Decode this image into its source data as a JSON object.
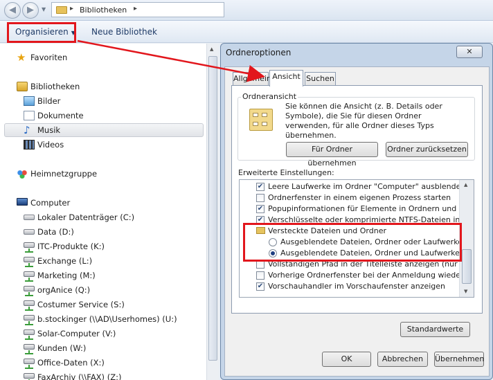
{
  "address_bar": {
    "path": "Bibliotheken"
  },
  "toolbar": {
    "organize": "Organisieren",
    "new_library": "Neue Bibliothek"
  },
  "nav": {
    "favorites": "Favoriten",
    "libraries": "Bibliotheken",
    "library_items": [
      "Bilder",
      "Dokumente",
      "Musik",
      "Videos"
    ],
    "homegroup": "Heimnetzgruppe",
    "computer": "Computer",
    "drives": [
      "Lokaler Datenträger (C:)",
      "Data (D:)",
      "ITC-Produkte (K:)",
      "Exchange (L:)",
      "Marketing (M:)",
      "orgAnice (Q:)",
      "Costumer Service (S:)",
      "b.stockinger (\\\\AD\\Userhomes) (U:)",
      "Solar-Computer (V:)",
      "Kunden (W:)",
      "Office-Daten (X:)",
      "FaxArchiv (\\\\FAX) (Z:)"
    ]
  },
  "dialog": {
    "title": "Ordneroptionen",
    "close": "✕",
    "tabs": [
      "Allgemein",
      "Ansicht",
      "Suchen"
    ],
    "folder_view": {
      "title": "Ordneransicht",
      "description": "Sie können die Ansicht (z. B. Details oder Symbole), die Sie für diesen Ordner verwenden, für alle Ordner dieses Typs übernehmen.",
      "apply_button": "Für Ordner übernehmen",
      "reset_button": "Ordner zurücksetzen"
    },
    "advanced_label": "Erweiterte Einstellungen:",
    "advanced_items": [
      {
        "kind": "checkbox",
        "checked": true,
        "text": "Leere Laufwerke im Ordner \"Computer\" ausblenden"
      },
      {
        "kind": "checkbox",
        "checked": false,
        "text": "Ordnerfenster in einem eigenen Prozess starten"
      },
      {
        "kind": "checkbox",
        "checked": true,
        "text": "Popupinformationen für Elemente in Ordnern und auf dem D"
      },
      {
        "kind": "checkbox",
        "checked": true,
        "text": "Verschlüsselte oder komprimierte NTFS-Dateien in anderer"
      },
      {
        "kind": "folder",
        "text": "Versteckte Dateien und Ordner"
      },
      {
        "kind": "radio",
        "checked": false,
        "text": "Ausgeblendete Dateien, Ordner oder Laufwerke nicht a"
      },
      {
        "kind": "radio",
        "checked": true,
        "text": "Ausgeblendete Dateien, Ordner und Laufwerke anzeig"
      },
      {
        "kind": "checkbox",
        "checked": false,
        "text": "Vollständigen Pfad in der Titelleiste anzeigen (nur klassisch"
      },
      {
        "kind": "checkbox",
        "checked": false,
        "text": "Vorherige Ordnerfenster bei der Anmeldung wiederherstellen"
      },
      {
        "kind": "checkbox",
        "checked": true,
        "text": "Vorschauhandler im Vorschaufenster anzeigen"
      }
    ],
    "defaults_button": "Standardwerte",
    "ok_button": "OK",
    "cancel_button": "Abbrechen",
    "apply_button": "Übernehmen"
  },
  "colors": {
    "annotation_red": "#e2161c",
    "toolbar_text": "#1e3a66"
  },
  "icons": [
    "back-arrow-icon",
    "forward-arrow-icon",
    "folder-icon",
    "star-icon",
    "library-icon",
    "pictures-icon",
    "documents-icon",
    "music-icon",
    "videos-icon",
    "homegroup-icon",
    "computer-icon",
    "drive-icon",
    "network-drive-icon"
  ]
}
